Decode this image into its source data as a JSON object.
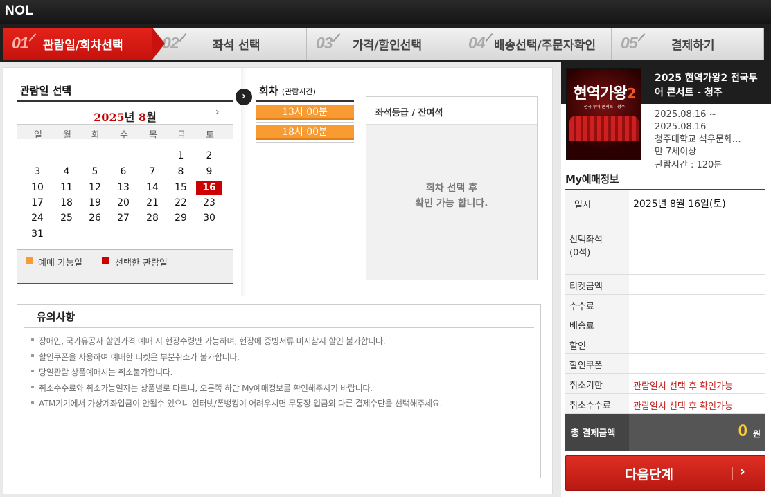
{
  "app": {
    "brand": "NOL"
  },
  "steps": [
    {
      "num": "01",
      "label": "관람일/회차선택",
      "active": true
    },
    {
      "num": "02",
      "label": "좌석 선택"
    },
    {
      "num": "03",
      "label": "가격/할인선택"
    },
    {
      "num": "04",
      "label": "배송선택/주문자확인"
    },
    {
      "num": "05",
      "label": "결제하기"
    }
  ],
  "calendar": {
    "title": "관람일 선택",
    "year": "2025",
    "year_suffix": "년",
    "month": "8",
    "month_suffix": "월",
    "next_icon": "chevron-right-icon",
    "weekdays": [
      "일",
      "월",
      "화",
      "수",
      "목",
      "금",
      "토"
    ],
    "weeks": [
      [
        "",
        "",
        "",
        "",
        "",
        "1",
        "2"
      ],
      [
        "3",
        "4",
        "5",
        "6",
        "7",
        "8",
        "9"
      ],
      [
        "10",
        "11",
        "12",
        "13",
        "14",
        "15",
        "16"
      ],
      [
        "17",
        "18",
        "19",
        "20",
        "21",
        "22",
        "23"
      ],
      [
        "24",
        "25",
        "26",
        "27",
        "28",
        "29",
        "30"
      ],
      [
        "31",
        "",
        "",
        "",
        "",
        "",
        ""
      ]
    ],
    "selected_day": "16",
    "legend": [
      {
        "label": "예매 가능일",
        "color": "#f89b33"
      },
      {
        "label": "선택한 관람일",
        "color": "#cc0000"
      }
    ]
  },
  "rounds": {
    "title": "회차",
    "subtitle": "(관람시간)",
    "times": [
      "13시 00분",
      "18시 00분"
    ]
  },
  "grade": {
    "title": "좌석등급 / 잔여석",
    "message_line1": "회차 선택 후",
    "message_line2": "확인 가능 합니다."
  },
  "notice": {
    "title": "유의사항",
    "item1_pre": "장애인, 국가유공자 할인가격 예매 시 현장수령만 가능하며, 현장에 ",
    "item1_u": "증빙서류 미지참시 할인 불가",
    "item1_post": "합니다.",
    "item2_u": "할인쿠폰을 사용하여 예매한 티켓은 부분취소가 불가",
    "item2_post": "합니다.",
    "item3": "당일관람 상품예매시는 취소불가합니다.",
    "item4": "취소수수료와 취소가능일자는 상품별로 다르니, 오른쪽 하단 My예매정보를 확인해주시기 바랍니다.",
    "item5": "ATM기기에서 가상계좌입금이 안될수 있으니 인터넷/폰뱅킹이 어려우시면 무통장 입금외 다른 결제수단을 선택해주세요."
  },
  "event": {
    "title": "2025 현역가왕2 전국투어 콘서트 - 청주",
    "date_from": "2025.08.16 ~",
    "date_to": "2025.08.16",
    "venue": "청주대학교 석우문화…",
    "age": "만 7세이상",
    "runtime": "관람시간 : 120분",
    "poster_title": "현역가왕",
    "poster_num": "2",
    "poster_sub": "전국 투어 콘서트 - 청주"
  },
  "my_booking": {
    "title": "My예매정보",
    "rows": {
      "date_label": "일시",
      "date_value": "2025년 8월 16일(토)",
      "seat_label": "선택좌석",
      "seat_count": "(0석)",
      "ticket_label": "티켓금액",
      "fee_label": "수수료",
      "shipping_label": "배송료",
      "discount_label": "할인",
      "coupon_label": "할인쿠폰",
      "cancel_deadline_label": "취소기한",
      "cancel_deadline_value": "관람일시 선택 후 확인가능",
      "cancel_fee_label": "취소수수료",
      "cancel_fee_value": "관람일시 선택 후 확인가능"
    },
    "total_label": "총 결제금액",
    "total_value": "0",
    "total_unit": "원",
    "next_label": "다음단계"
  }
}
